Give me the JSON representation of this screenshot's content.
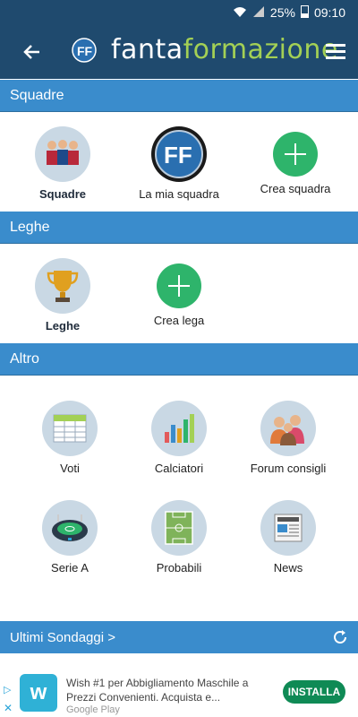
{
  "statusbar": {
    "battery": "25%",
    "time": "09:10"
  },
  "appbar": {
    "brand_part1": "fanta",
    "brand_part2": "formazione"
  },
  "sections": {
    "squadre": {
      "title": "Squadre",
      "items": [
        {
          "label": "Squadre"
        },
        {
          "label": "La mia squadra"
        },
        {
          "label": "Crea squadra"
        }
      ]
    },
    "leghe": {
      "title": "Leghe",
      "items": [
        {
          "label": "Leghe"
        },
        {
          "label": "Crea lega"
        }
      ]
    },
    "altro": {
      "title": "Altro",
      "items": [
        {
          "label": "Voti"
        },
        {
          "label": "Calciatori"
        },
        {
          "label": "Forum consigli"
        },
        {
          "label": "Serie A"
        },
        {
          "label": "Probabili"
        },
        {
          "label": "News"
        }
      ]
    }
  },
  "ultimi": {
    "title": "Ultimi Sondaggi >"
  },
  "ad": {
    "text": "Wish #1 per Abbigliamento Maschile a Prezzi Convenienti. Acquista e...",
    "cta": "INSTALLA",
    "store": "Google Play"
  },
  "colors": {
    "primary_dark": "#1f4a6e",
    "section_blue": "#3a8ccc",
    "accent_green": "#2eb46b",
    "brand_green": "#a3d055"
  }
}
